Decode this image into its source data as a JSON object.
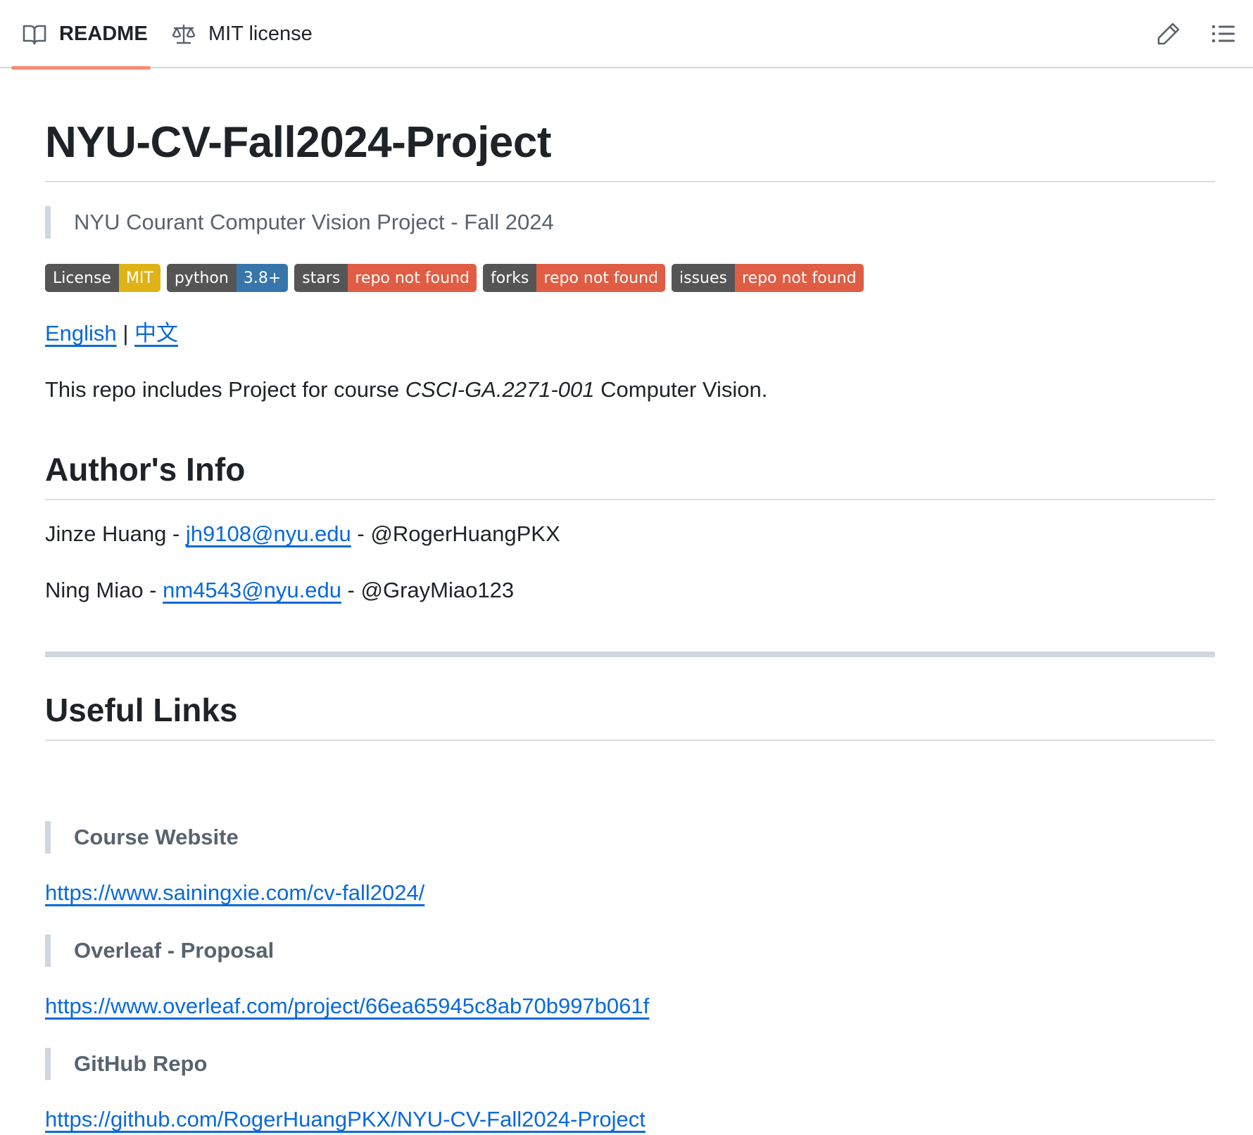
{
  "tabs": {
    "readme_label": "README",
    "license_label": "MIT license"
  },
  "readme": {
    "title": "NYU-CV-Fall2024-Project",
    "subtitle": "NYU Courant Computer Vision Project - Fall 2024",
    "badges": [
      {
        "label": "License",
        "value": "MIT",
        "color": "#dfb317"
      },
      {
        "label": "python",
        "value": "3.8+",
        "color": "#3776ab"
      },
      {
        "label": "stars",
        "value": "repo not found",
        "color": "#e05d44"
      },
      {
        "label": "forks",
        "value": "repo not found",
        "color": "#e05d44"
      },
      {
        "label": "issues",
        "value": "repo not found",
        "color": "#e05d44"
      }
    ],
    "lang": {
      "english": "English",
      "separator": "|",
      "chinese": "中文"
    },
    "intro": {
      "before": "This repo includes Project for course ",
      "course": "CSCI-GA.2271-001",
      "after": " Computer Vision."
    },
    "authors_heading": "Author's Info",
    "authors": [
      {
        "name": "Jinze Huang",
        "sep1": " - ",
        "email": "jh9108@nyu.edu",
        "sep2": " - ",
        "handle": "@RogerHuangPKX"
      },
      {
        "name": "Ning Miao",
        "sep1": " - ",
        "email": "nm4543@nyu.edu",
        "sep2": " - ",
        "handle": "@GrayMiao123"
      }
    ],
    "links_heading": "Useful Links",
    "links": [
      {
        "title": "Course Website",
        "url": "https://www.sainingxie.com/cv-fall2024/"
      },
      {
        "title": "Overleaf - Proposal",
        "url": "https://www.overleaf.com/project/66ea65945c8ab70b997b061f"
      },
      {
        "title": "GitHub Repo",
        "url": "https://github.com/RogerHuangPKX/NYU-CV-Fall2024-Project"
      }
    ]
  },
  "icons": {
    "readme_tab": "book-icon",
    "license_tab": "scale-icon",
    "edit": "pencil-icon",
    "outline": "list-icon"
  },
  "colors": {
    "link": "#0969da",
    "active_tab_underline": "#fd8c73",
    "badge_label_bg": "#555555"
  }
}
